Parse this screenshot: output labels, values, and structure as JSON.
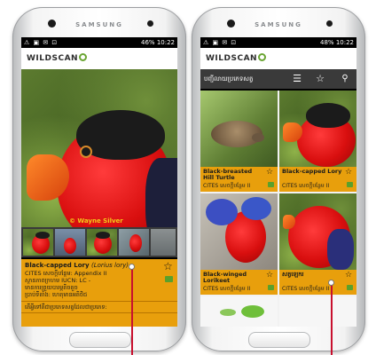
{
  "device": {
    "brand": "SAMSUNG"
  },
  "status_bar": {
    "time": "10:22",
    "battery_left": "46%",
    "battery_right": "48%"
  },
  "app": {
    "logo": "WILDSCAN"
  },
  "detail": {
    "credit": "© Wayne Silver",
    "common_name": "Black-capped Lory",
    "scientific_name": "(Lorius lory)",
    "cites_line": "CITES សេចក្តីបន្ថែម: Appendix II",
    "iucn_line": "ស្ថានភាពក្រហម IUCN: LC -",
    "iucn_line2": "មានការព្រួយបារម្ភតិចតួច",
    "distribution_line": "ប្រាប់ទីតាំង: ហេតុមានអតិថិជ",
    "footer_line": "តើអ្វីទៅគឺជាប្រភេទសត្វដែលជាប្រភេទ:"
  },
  "list": {
    "category_label": "បញ្ជីលាយប្រភេទសត្វ",
    "items": [
      {
        "name": "Black-breasted Hill Turtle",
        "cites": "CITES សេចក្តីបន្ថែម II"
      },
      {
        "name": "Black-capped Lory",
        "cites": "CITES សេចក្តីបន្ថែម II"
      },
      {
        "name": "Black-winged Lorikeet",
        "cites": "CITES សេចក្តីបន្ថែម II"
      },
      {
        "name": "សត្វឡេករ",
        "cites": "CITES សេចក្តីបន្ថែម II"
      }
    ]
  },
  "icons": {
    "menu": "menu-icon",
    "favorite": "star-icon",
    "search": "search-icon"
  },
  "colors": {
    "accent": "#e89f0c",
    "pointer": "#c8102e",
    "toolbar": "#3a3a3a"
  }
}
